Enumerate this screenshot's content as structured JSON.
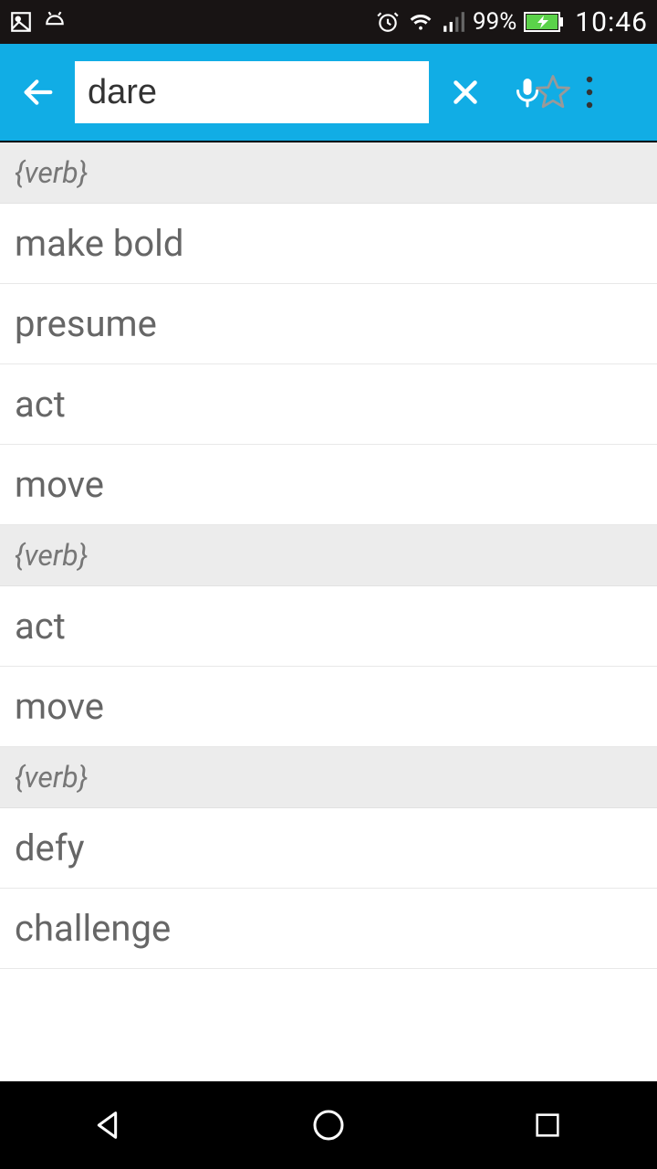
{
  "status": {
    "battery_pct": "99%",
    "time": "10:46"
  },
  "search": {
    "value": "dare"
  },
  "sections": [
    {
      "label": "{verb}",
      "items": [
        "make bold",
        "presume",
        "act",
        "move"
      ]
    },
    {
      "label": "{verb}",
      "items": [
        "act",
        "move"
      ]
    },
    {
      "label": "{verb}",
      "items": [
        "defy",
        "challenge"
      ]
    }
  ]
}
